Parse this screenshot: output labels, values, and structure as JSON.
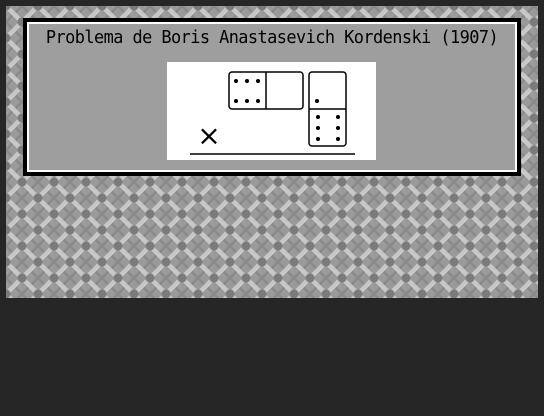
{
  "panel": {
    "title": "Problema de Boris Anastasevich Kordenski (1907)"
  },
  "puzzle": {
    "operator_symbol": "×",
    "dominoes": [
      {
        "name": "domino-horizontal",
        "pips": [
          6,
          0
        ]
      },
      {
        "name": "domino-vertical",
        "pips": [
          1,
          6
        ]
      }
    ]
  },
  "colors": {
    "background": "#262626",
    "stage": "#9a9a9a",
    "panel": "#9e9e9e",
    "puzzle_area": "#ffffff",
    "border": "#000000"
  }
}
